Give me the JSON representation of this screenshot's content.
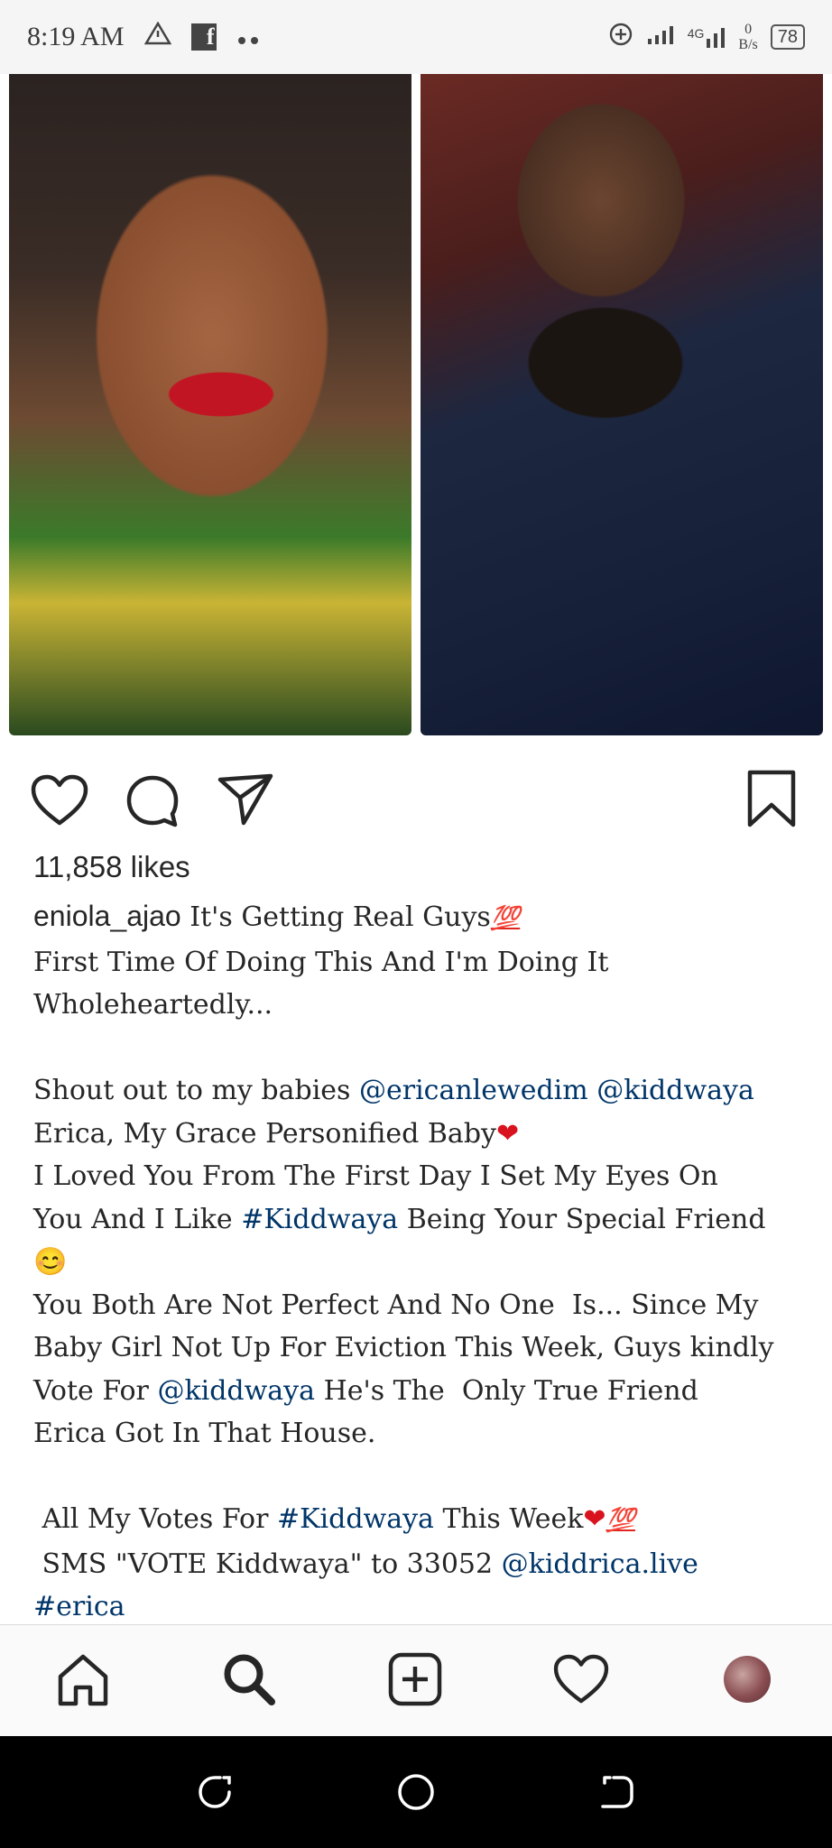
{
  "status_bar": {
    "time": "8:19 AM",
    "notification_icons": [
      "warning-triangle-icon",
      "facebook-icon",
      "more-dots-icon"
    ],
    "network_label": "4G",
    "speed_value": "0",
    "speed_unit": "B/s",
    "battery": "78"
  },
  "post": {
    "likes": "11,858 likes",
    "username": "eniola_ajao",
    "caption_lines": [
      [
        {
          "t": "It's Getting Real Guys"
        },
        {
          "t": "💯",
          "c": "em-100"
        }
      ],
      [
        {
          "t": "First Time Of Doing This And I'm Doing It"
        }
      ],
      [
        {
          "t": "Wholeheartedly..."
        }
      ],
      [],
      [
        {
          "t": "Shout out to my babies "
        },
        {
          "t": "@ericanlewedim",
          "c": "tag"
        },
        {
          "t": " "
        },
        {
          "t": "@kiddwaya",
          "c": "tag"
        }
      ],
      [
        {
          "t": "Erica, My Grace Personified Baby"
        },
        {
          "t": "❤",
          "c": "em-red"
        }
      ],
      [
        {
          "t": "I Loved You From The First Day I Set My Eyes On"
        }
      ],
      [
        {
          "t": "You And I Like "
        },
        {
          "t": "#Kiddwaya",
          "c": "tag"
        },
        {
          "t": " Being Your Special Friend"
        }
      ],
      [
        {
          "t": "😊"
        }
      ],
      [
        {
          "t": "You Both Are Not Perfect And No One  Is... Since My"
        }
      ],
      [
        {
          "t": "Baby Girl Not Up For Eviction This Week, Guys kindly"
        }
      ],
      [
        {
          "t": "Vote For "
        },
        {
          "t": "@kiddwaya",
          "c": "tag"
        },
        {
          "t": " He's The  Only True Friend"
        }
      ],
      [
        {
          "t": "Erica Got In That House."
        }
      ],
      [],
      [
        {
          "t": " All My Votes For "
        },
        {
          "t": "#Kiddwaya",
          "c": "tag"
        },
        {
          "t": " This Week"
        },
        {
          "t": "❤",
          "c": "em-red"
        },
        {
          "t": "💯",
          "c": "em-100"
        }
      ],
      [
        {
          "t": " SMS \"VOTE Kiddwaya\" to 33052 "
        },
        {
          "t": "@kiddrica.live",
          "c": "tag"
        }
      ],
      [
        {
          "t": "#erica",
          "c": "tag"
        }
      ]
    ]
  },
  "colors": {
    "link": "#003569",
    "text": "#262626",
    "nav_bg": "#fafafa",
    "system_nav_bg": "#000000"
  },
  "bottom_nav": [
    "home-icon",
    "search-icon",
    "new-post-icon",
    "activity-heart-icon",
    "profile-avatar"
  ],
  "system_nav": [
    "recents-icon",
    "home-circle-icon",
    "back-icon"
  ]
}
